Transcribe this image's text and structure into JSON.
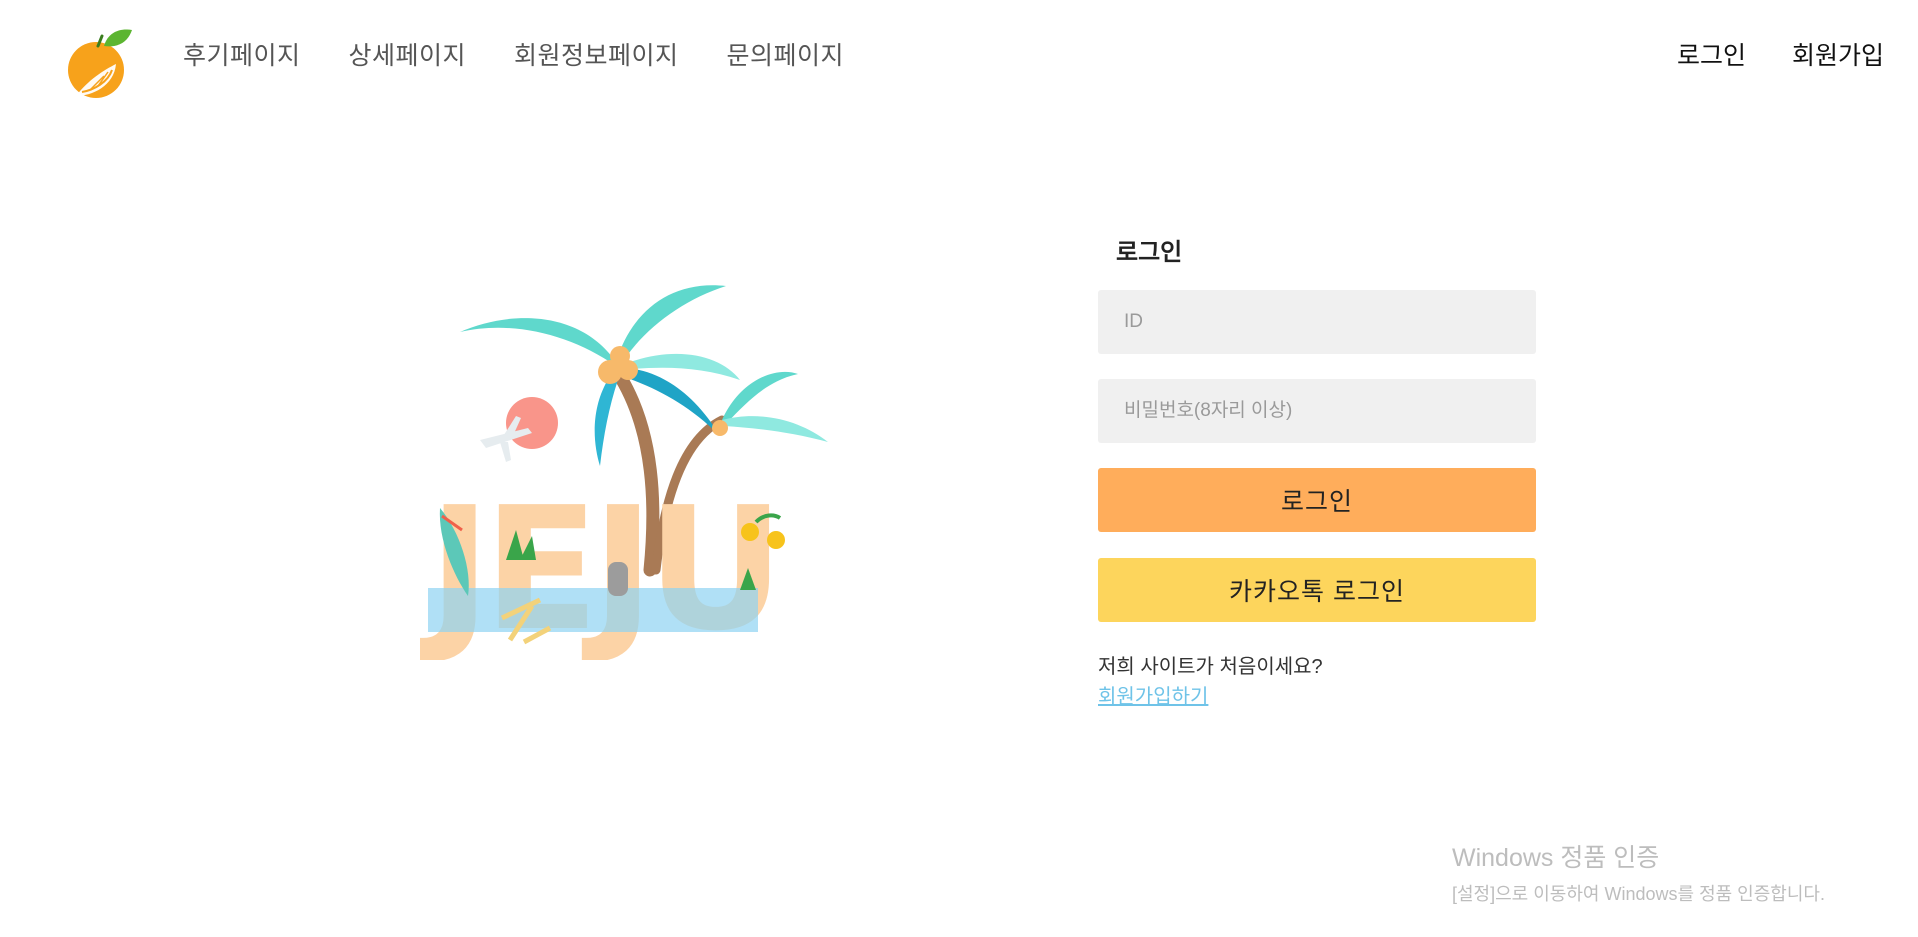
{
  "nav": {
    "items": [
      {
        "label": "후기페이지"
      },
      {
        "label": "상세페이지"
      },
      {
        "label": "회원정보페이지"
      },
      {
        "label": "문의페이지"
      }
    ]
  },
  "auth": {
    "login": "로그인",
    "signup": "회원가입"
  },
  "hero": {
    "text": "JEJU"
  },
  "login": {
    "title": "로그인",
    "id_placeholder": "ID",
    "id_value": "",
    "password_placeholder": "비밀번호(8자리 이상)",
    "password_value": "",
    "login_button": "로그인",
    "kakao_button": "카카오톡 로그인",
    "signup_question": "저희 사이트가 처음이세요?",
    "signup_link": "회원가입하기"
  },
  "watermark": {
    "title": "Windows 정품 인증",
    "subtitle": "[설정]으로 이동하여 Windows를 정품 인증합니다."
  },
  "colors": {
    "login_button": "#ffad5b",
    "kakao_button": "#fdd55c",
    "input_bg": "#f0f0f0",
    "link": "#6fc3e8",
    "orange_logo": "#f7a21b",
    "leaf": "#5cb531"
  },
  "icons": {
    "logo": "orange-fruit-logo",
    "hero": "jeju-palm-illustration"
  }
}
